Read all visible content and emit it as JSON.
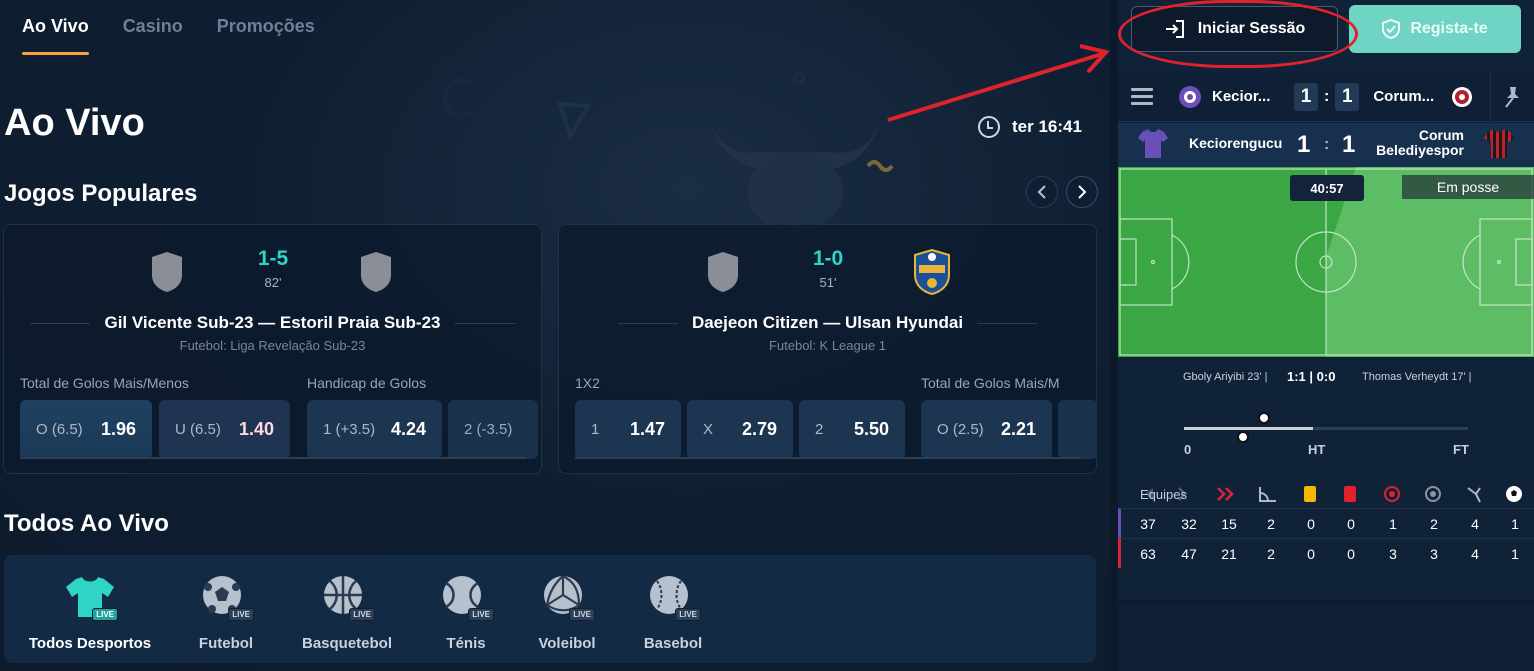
{
  "nav": {
    "tabs": [
      {
        "label": "Ao Vivo",
        "active": true
      },
      {
        "label": "Casino"
      },
      {
        "label": "Promoções"
      }
    ]
  },
  "page_title": "Ao Vivo",
  "clock_time": "ter 16:41",
  "sections": {
    "popular": "Jogos Populares",
    "all_live": "Todos Ao Vivo"
  },
  "popular_matches": [
    {
      "score": "1-5",
      "minute": "82'",
      "title": "Gil Vicente Sub-23 — Estoril Praia Sub-23",
      "league": "Futebol: Liga Revelação Sub-23",
      "markets": [
        "Total de Golos Mais/Menos",
        "Handicap de Golos"
      ],
      "odds": [
        {
          "label": "O (6.5)",
          "value": "1.96"
        },
        {
          "label": "U (6.5)",
          "value": "1.40"
        },
        {
          "label": "1 (+3.5)",
          "value": "4.24"
        },
        {
          "label": "2 (-3.5)",
          "value": ""
        }
      ]
    },
    {
      "score": "1-0",
      "minute": "51'",
      "title": "Daejeon Citizen — Ulsan Hyundai",
      "league": "Futebol: K League 1",
      "markets": [
        "1X2",
        "Total de Golos Mais/M"
      ],
      "odds": [
        {
          "label": "1",
          "value": "1.47"
        },
        {
          "label": "X",
          "value": "2.79"
        },
        {
          "label": "2",
          "value": "5.50"
        },
        {
          "label": "O (2.5)",
          "value": "2.21"
        }
      ]
    }
  ],
  "sports": [
    {
      "label": "Todos Desportos",
      "icon": "shirt-icon",
      "active": true
    },
    {
      "label": "Futebol",
      "icon": "football-icon"
    },
    {
      "label": "Basquetebol",
      "icon": "basketball-icon"
    },
    {
      "label": "Ténis",
      "icon": "tennis-icon"
    },
    {
      "label": "Voleibol",
      "icon": "volleyball-icon"
    },
    {
      "label": "Basebol",
      "icon": "baseball-icon"
    }
  ],
  "live_badge": "LIVE",
  "auth": {
    "login": "Iniciar Sessão",
    "register": "Regista-te"
  },
  "scorebar": {
    "home": "Kecior...",
    "away": "Corum...",
    "home_score": "1",
    "away_score": "1",
    "separator": ":"
  },
  "match_detail": {
    "home": "Keciorengucu",
    "away_line1": "Corum",
    "away_line2": "Belediyespor",
    "home_score": "1",
    "away_score": "1",
    "separator": ":",
    "time": "40:57",
    "possession": "Em posse",
    "home_scorer": "Gboly Ariyibi 23' |",
    "away_scorer": "Thomas Verheydt 17' |",
    "ht_score": "1:1 | 0:0",
    "timeline_labels": [
      "0",
      "HT",
      "FT"
    ],
    "timeline_progress": 0.455
  },
  "stats": {
    "header": "Equipes",
    "icons": [
      "attack-icon",
      "dangerous-attack-icon",
      "corner-icon",
      "yellow-card-icon",
      "red-card-icon",
      "shot-on-target-icon",
      "shot-off-target-icon",
      "penalty-icon",
      "goal-icon"
    ],
    "rows": [
      {
        "team": "home",
        "values": [
          "37",
          "32",
          "15",
          "2",
          "0",
          "0",
          "1",
          "2",
          "4",
          "1"
        ]
      },
      {
        "team": "away",
        "values": [
          "63",
          "47",
          "21",
          "2",
          "0",
          "0",
          "3",
          "3",
          "4",
          "1"
        ]
      }
    ]
  },
  "colors": {
    "accent_teal": "#2fd4c6",
    "nav_underline": "#f2a43a",
    "register_bg": "#6fd4c4",
    "annotation_red": "#e0222b",
    "home_color": "#6b4fb8",
    "away_color": "#d9243a"
  }
}
